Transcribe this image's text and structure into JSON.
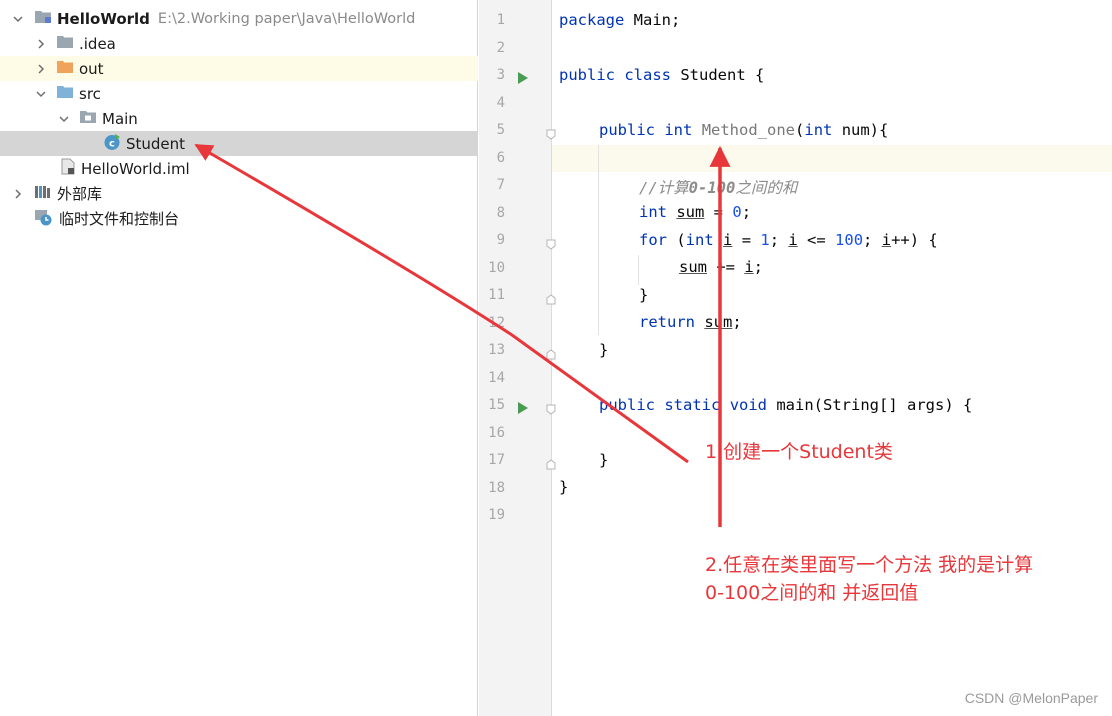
{
  "project_tree": {
    "root": {
      "name": "HelloWorld",
      "path": "E:\\2.Working paper\\Java\\HelloWorld"
    },
    "items": [
      {
        "label": ".idea"
      },
      {
        "label": "out"
      },
      {
        "label": "src"
      },
      {
        "label": "Main"
      },
      {
        "label": "Student"
      },
      {
        "label": "HelloWorld.iml"
      },
      {
        "label": "外部库"
      },
      {
        "label": "临时文件和控制台"
      }
    ]
  },
  "editor": {
    "line_numbers": [
      "1",
      "2",
      "3",
      "4",
      "5",
      "6",
      "7",
      "8",
      "9",
      "10",
      "11",
      "12",
      "13",
      "14",
      "15",
      "16",
      "17",
      "18",
      "19"
    ],
    "code": {
      "l1": [
        "package",
        " Main;"
      ],
      "l3": [
        "public",
        " ",
        "class",
        " Student {"
      ],
      "l5": [
        "public",
        " ",
        "int",
        " ",
        "Method_one",
        "(",
        "int",
        " num){"
      ],
      "l7": [
        "//计算",
        "0-100",
        "之间的和"
      ],
      "l8": [
        "int",
        " ",
        "sum",
        " = ",
        "0",
        ";"
      ],
      "l9": [
        "for",
        " (",
        "int",
        " ",
        "i",
        " = ",
        "1",
        "; ",
        "i",
        " <= ",
        "100",
        "; ",
        "i",
        "++) {"
      ],
      "l10": [
        "sum",
        " += ",
        "i",
        ";"
      ],
      "l11": "}",
      "l12": [
        "return",
        " ",
        "sum",
        ";"
      ],
      "l13": "}",
      "l15": [
        "public",
        " ",
        "static",
        " ",
        "void",
        " main(String[] args) {"
      ],
      "l17": "}",
      "l18": "}"
    }
  },
  "annotations": {
    "note1": "1.创建一个Student类",
    "note2_line1": "2.任意在类里面写一个方法 我的是计算",
    "note2_line2": "0-100之间的和 并返回值",
    "color": "#e8373b"
  },
  "watermark": "CSDN @MelonPaper",
  "colors": {
    "keyword": "#0033b3",
    "number": "#1750eb",
    "comment": "#8c8c8c",
    "gutter_bg": "#f3f3f3",
    "selected_row": "#d5d5d5",
    "current_line": "#fcfaed"
  }
}
